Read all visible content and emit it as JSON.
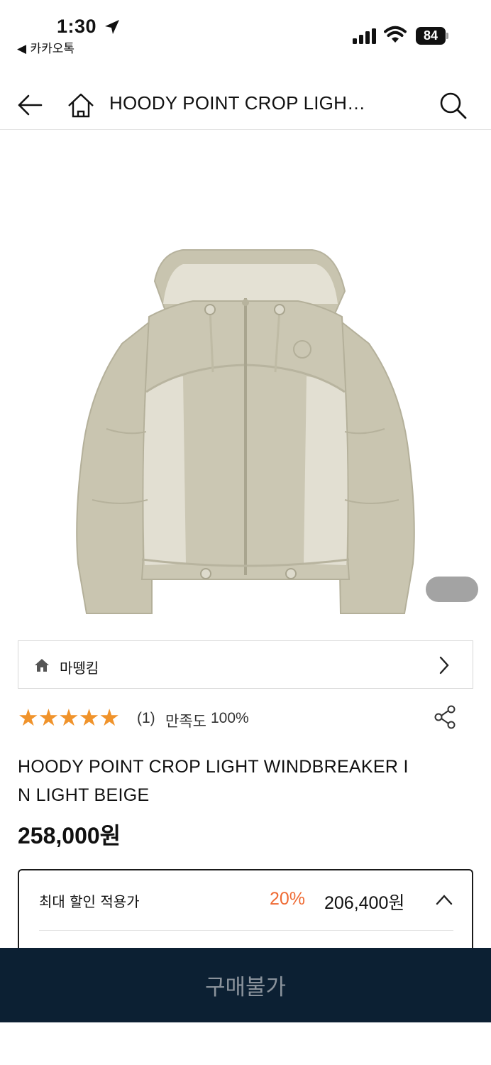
{
  "status_bar": {
    "time": "1:30",
    "back_app": "◀ 카카오톡",
    "battery": "84"
  },
  "nav": {
    "title": "HOODY POINT CROP LIGH…",
    "icons": [
      "back-arrow-icon",
      "home-icon",
      "search-icon"
    ]
  },
  "product": {
    "image_alt": "light beige hooded crop windbreaker",
    "brand": "마뗑킴",
    "stars": "★★★★★",
    "rating_value": 5,
    "review_count": "(1)",
    "satisfaction_label": "만족도",
    "satisfaction_value": "100%",
    "name": "HOODY POINT CROP LIGHT WINDBREAKER IN LIGHT BEIGE",
    "price": "258,000",
    "currency": "원"
  },
  "discount": {
    "label": "최대 할인 적용가",
    "rate": "20%",
    "price": "206,400원"
  },
  "buy_button": {
    "label": "구매불가"
  },
  "colors": {
    "accent_orange": "#ef6a33",
    "star": "#f0932b",
    "buy_bar": "#0c2033",
    "jacket": "#cfcbb8"
  }
}
